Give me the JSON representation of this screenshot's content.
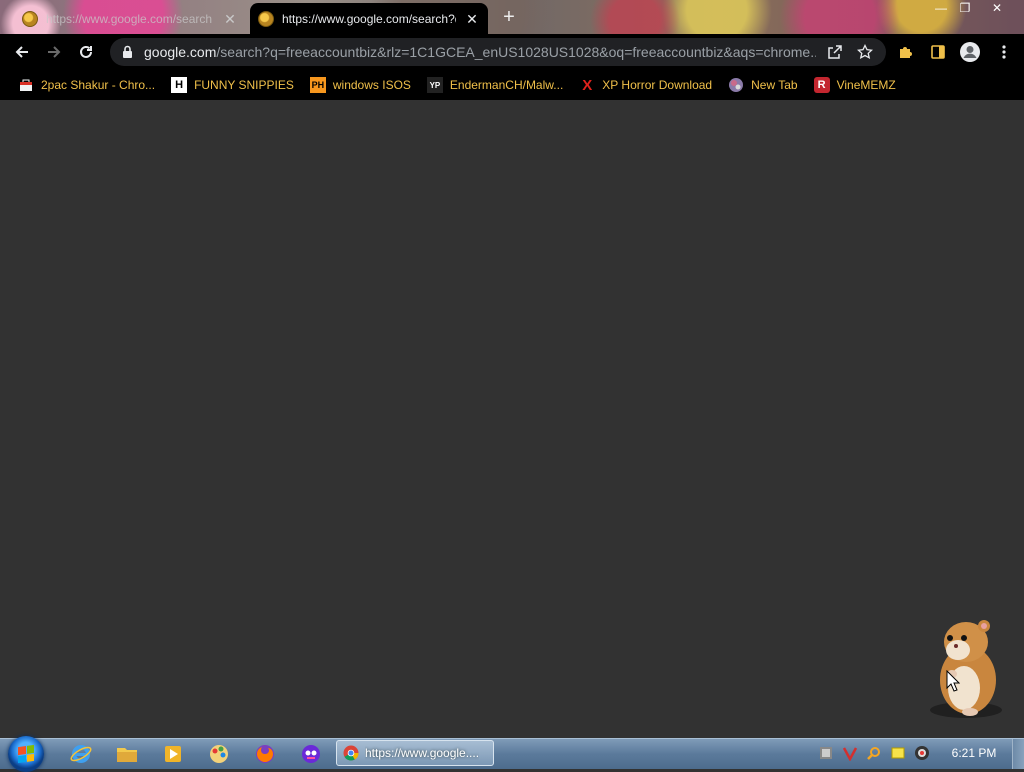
{
  "tabs": [
    {
      "title": "https://www.google.com/search",
      "active": false
    },
    {
      "title": "https://www.google.com/search?q=freeaccountbiz",
      "active": true
    }
  ],
  "window_controls": {
    "minimize": "—",
    "maximize": "❐",
    "close": "✕"
  },
  "toolbar": {
    "url_host": "google.com",
    "url_path": "/search?q=freeaccountbiz&rlz=1C1GCEA_enUS1028US1028&oq=freeaccountbiz&aqs=chrome...."
  },
  "bookmarks": [
    {
      "label": "2pac Shakur - Chro...",
      "icon": "bag-icon"
    },
    {
      "label": "FUNNY SNIPPIES",
      "icon": "H"
    },
    {
      "label": "windows ISOS",
      "icon": "PH"
    },
    {
      "label": "EndermanCH/Malw...",
      "icon": "YP"
    },
    {
      "label": "XP Horror Download",
      "icon": "X"
    },
    {
      "label": "New Tab",
      "icon": "globe-icon"
    },
    {
      "label": "VineMEMZ",
      "icon": "R"
    }
  ],
  "taskbar": {
    "active_task_title": "https://www.google....",
    "clock": "6:21 PM"
  },
  "colors": {
    "page_bg": "#323232",
    "toolbar_bg": "#000000",
    "bookmark_text": "#f0c04a",
    "omnibox_bg": "#202124"
  }
}
